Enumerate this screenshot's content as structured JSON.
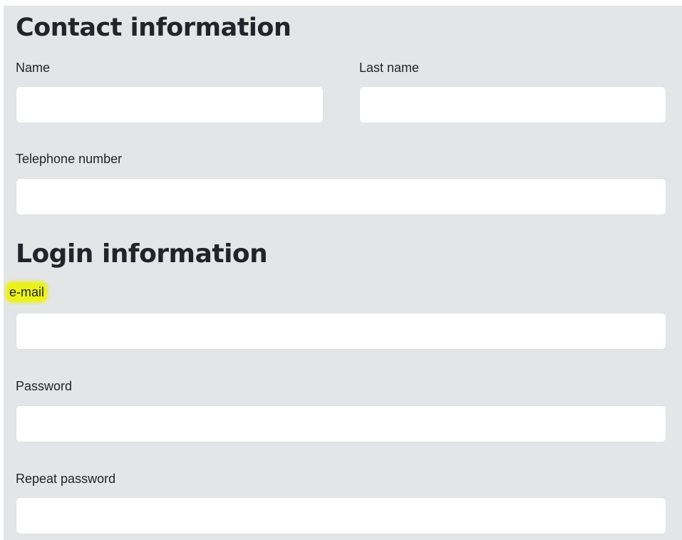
{
  "sections": {
    "contact": {
      "title": "Contact information",
      "fields": {
        "name": {
          "label": "Name",
          "value": ""
        },
        "last_name": {
          "label": "Last name",
          "value": ""
        },
        "telephone": {
          "label": "Telephone number",
          "value": ""
        }
      }
    },
    "login": {
      "title": "Login information",
      "fields": {
        "email": {
          "label": "e-mail",
          "value": "",
          "highlight_color": "#ebf21a"
        },
        "password": {
          "label": "Password",
          "value": ""
        },
        "repeat_password": {
          "label": "Repeat password",
          "value": ""
        }
      }
    }
  },
  "colors": {
    "panel_background": "#e4e5e7",
    "input_background": "#ffffff",
    "text": "#212529"
  }
}
